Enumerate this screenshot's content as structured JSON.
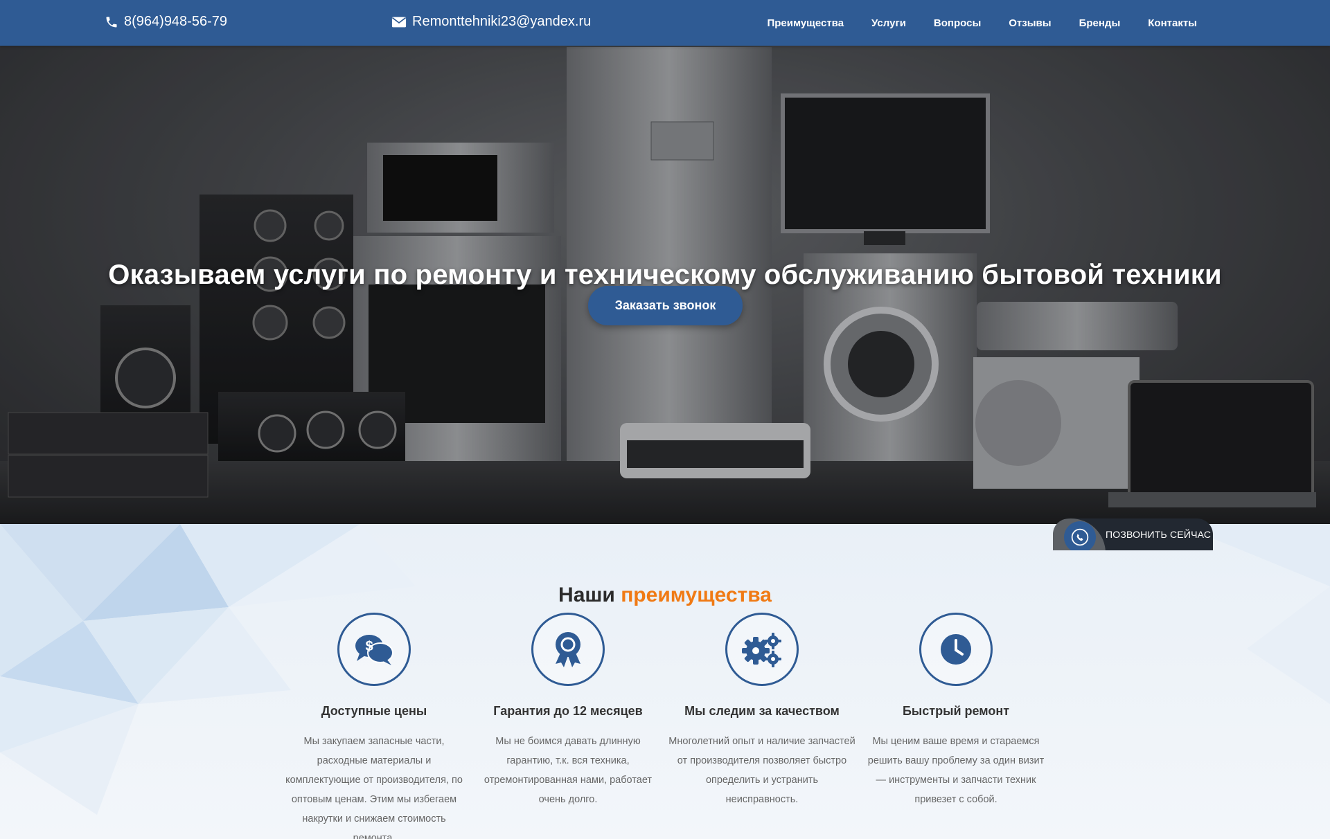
{
  "header": {
    "phone": "8(964)948-56-79",
    "email": "Remonttehniki23@yandex.ru",
    "nav": [
      "Преимущества",
      "Услуги",
      "Вопросы",
      "Отзывы",
      "Бренды",
      "Контакты"
    ]
  },
  "hero": {
    "title": "Оказываем услуги по ремонту и техническому обслуживанию бытовой техники",
    "cta_label": "Заказать звонок"
  },
  "callnow": {
    "label": "ПОЗВОНИТЬ СЕЙЧАС"
  },
  "features": {
    "title_part1": "Наши",
    "title_part2": "преимущества",
    "items": [
      {
        "icon": "price-chat-icon",
        "title": "Доступные цены",
        "text": "Мы закупаем запасные части, расходные материалы и комплектующие от производителя, по оптовым ценам. Этим мы избегаем накрутки и снижаем стоимость ремонта."
      },
      {
        "icon": "award-icon",
        "title": "Гарантия до 12 месяцев",
        "text": "Мы не боимся давать длинную гарантию, т.к. вся техника, отремонтированная нами, работает очень долго."
      },
      {
        "icon": "gears-icon",
        "title": "Мы следим за качеством",
        "text": "Многолетний опыт и наличие запчастей от производителя позволяет быстро определить и устранить неисправность."
      },
      {
        "icon": "clock-icon",
        "title": "Быстрый ремонт",
        "text": "Мы ценим ваше время и стараемся решить вашу проблему за один визит — инструменты и запчасти техник привезет с собой."
      }
    ]
  },
  "colors": {
    "brand": "#2f5b94",
    "accent": "#f07a14",
    "text": "#333333"
  }
}
